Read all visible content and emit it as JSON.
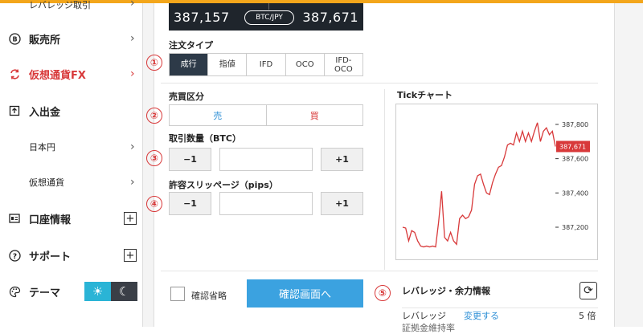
{
  "sidebar": {
    "partial_top": "レバレッジ取引",
    "items": [
      {
        "label": "販売所",
        "icon": "bitcoin-icon"
      },
      {
        "label": "仮想通貨FX",
        "icon": "swap-arrows-icon"
      },
      {
        "label": "入出金",
        "icon": "deposit-icon"
      },
      {
        "label": "日本円",
        "icon": ""
      },
      {
        "label": "仮想通貨",
        "icon": ""
      },
      {
        "label": "口座情報",
        "icon": "account-icon"
      },
      {
        "label": "サポート",
        "icon": "help-icon"
      },
      {
        "label": "テーマ",
        "icon": "palette-icon"
      }
    ],
    "plus_symbol": "+"
  },
  "priceboard": {
    "bid": "387,157",
    "pair": "BTC/JPY",
    "ask": "387,671"
  },
  "order_type": {
    "label": "注文タイプ",
    "options": [
      "成行",
      "指値",
      "IFD",
      "OCO",
      "IFD-\nOCO"
    ],
    "selected": "成行"
  },
  "side": {
    "label": "売買区分",
    "sell": "売",
    "buy": "買"
  },
  "quantity": {
    "label": "取引数量（BTC）",
    "minus": "−1",
    "plus": "+1",
    "value": ""
  },
  "slippage": {
    "label": "許容スリッページ（pips）",
    "minus": "−1",
    "plus": "+1",
    "value": ""
  },
  "markers": [
    "①",
    "②",
    "③",
    "④",
    "⑤"
  ],
  "chart_title": "Tickチャート",
  "chart_data": {
    "type": "line",
    "title": "Tickチャート",
    "ylim": [
      387050,
      387870
    ],
    "yticks": [
      387200,
      387400,
      387600,
      387800
    ],
    "ytick_labels": [
      "387,200",
      "387,400",
      "387,600",
      "387,800"
    ],
    "current_label": "387,671",
    "series": [
      {
        "values": [
          387200,
          387195,
          387120,
          387180,
          387170,
          387120,
          387090,
          387085,
          387090,
          387085,
          387090,
          387085,
          387230,
          387410,
          387140,
          387120,
          387170,
          387120,
          387100,
          387250,
          387270,
          387250,
          387260,
          387300,
          387450,
          387500,
          387510,
          387450,
          387400,
          387390,
          387460,
          387510,
          387550,
          387560,
          387610,
          387680,
          387690,
          387680,
          387750,
          387700,
          387760,
          387700,
          387750,
          387700,
          387760,
          387810,
          387700,
          387760,
          387780,
          387740,
          387760,
          387671
        ]
      }
    ]
  },
  "skip_confirm": "確認省略",
  "confirm_button": "確認画面へ",
  "leverage_panel": {
    "title": "レバレッジ・余力情報",
    "refresh_icon": "refresh-icon",
    "row_label": "レバレッジ",
    "change_link": "変更する",
    "row_value": "5 倍",
    "next_row_label": "証拠金維持率"
  },
  "colors": {
    "accent_orange": "#f3a61b",
    "active_red": "#d8393a",
    "sell_blue": "#2e8fd6",
    "confirm_blue": "#3ba2e0",
    "dark_navy": "#2d3a48"
  }
}
